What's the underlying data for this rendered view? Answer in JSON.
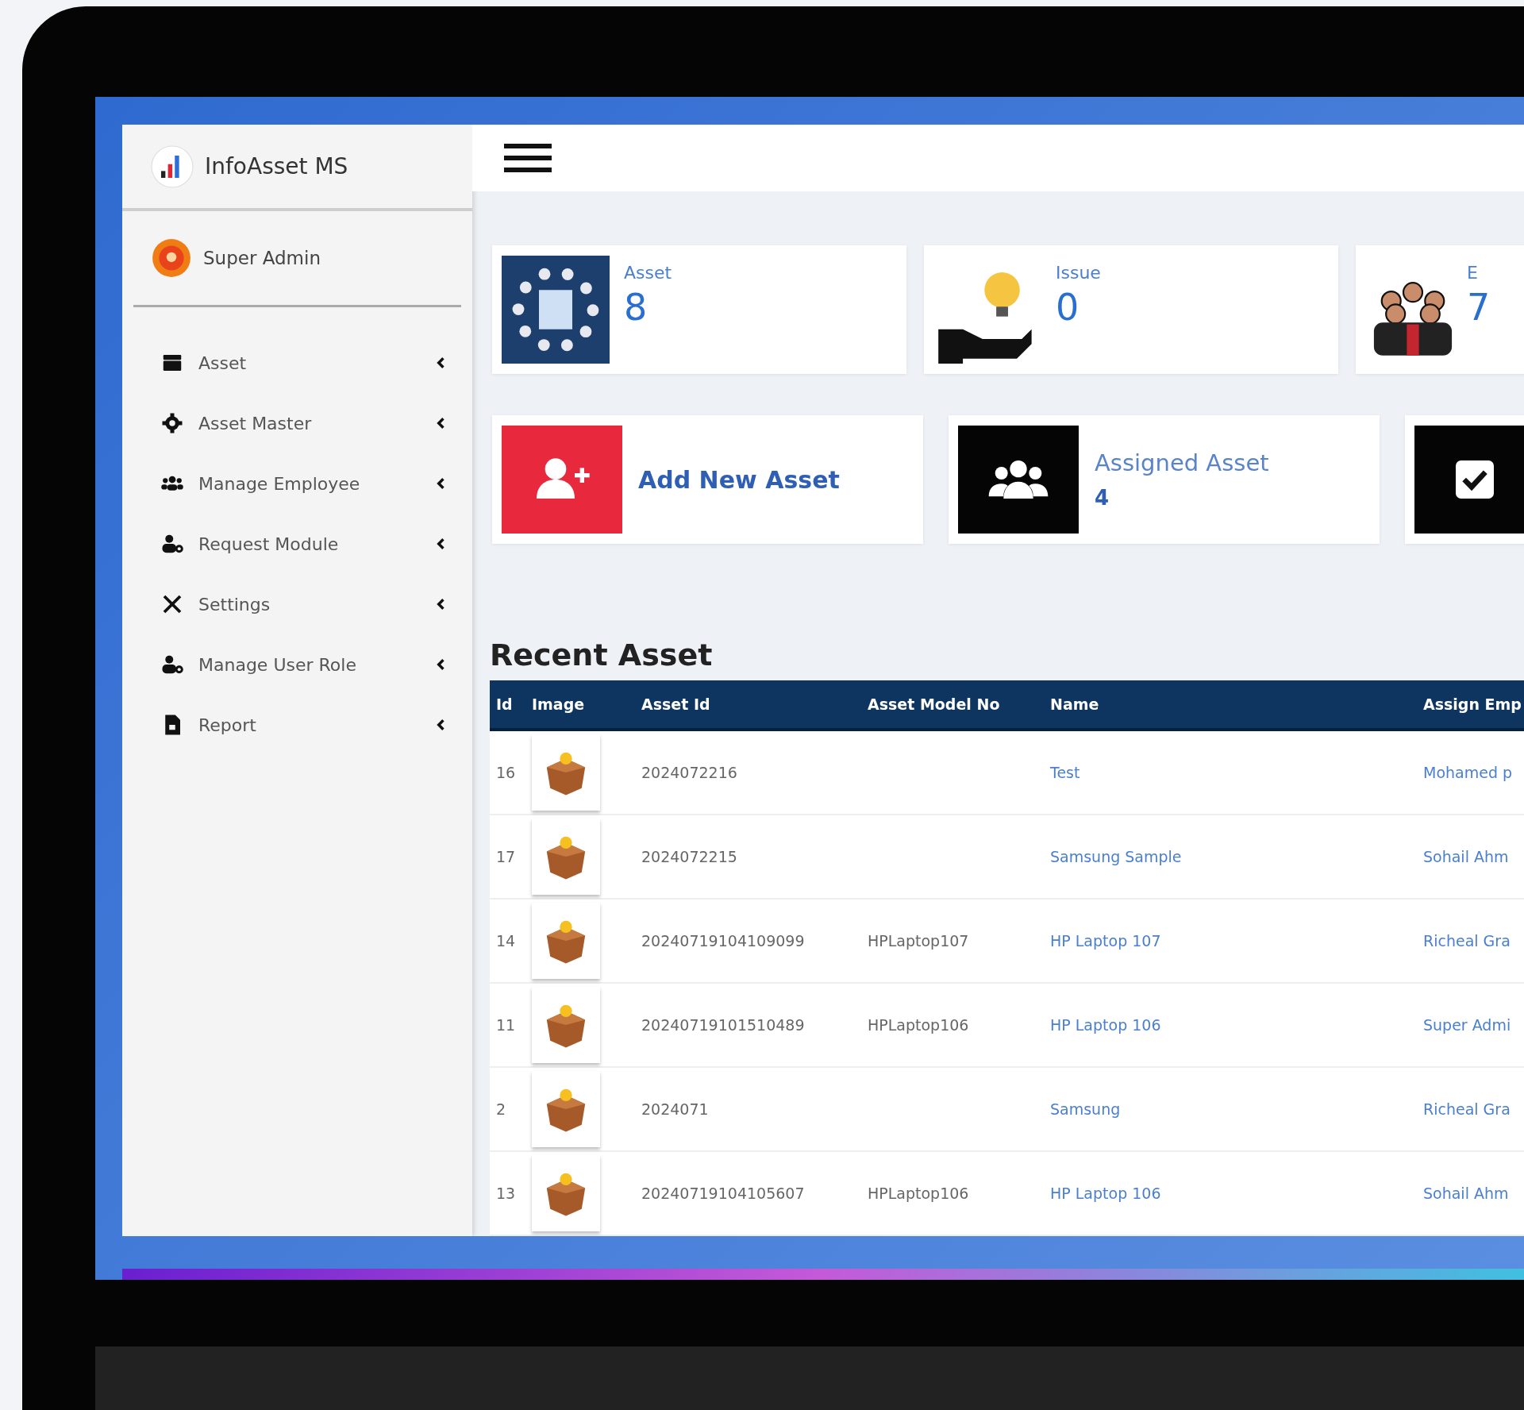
{
  "app": {
    "title": "InfoAsset MS"
  },
  "user": {
    "name": "Super Admin"
  },
  "menu": [
    {
      "label": "Asset",
      "kind": "box"
    },
    {
      "label": "Asset Master",
      "kind": "gear"
    },
    {
      "label": "Manage Employee",
      "kind": "users"
    },
    {
      "label": "Request Module",
      "kind": "user-gear"
    },
    {
      "label": "Settings",
      "kind": "tools"
    },
    {
      "label": "Manage User Role",
      "kind": "user-gear"
    },
    {
      "label": "Report",
      "kind": "file"
    }
  ],
  "stats": [
    {
      "label": "Asset",
      "value": "8",
      "kind": "asset"
    },
    {
      "label": "Issue",
      "value": "0",
      "kind": "issue"
    },
    {
      "label": "E",
      "value": "7",
      "kind": "team"
    }
  ],
  "actions": [
    {
      "label": "Add New Asset",
      "kind": "add"
    },
    {
      "label": "Assigned Asset",
      "value": "4",
      "kind": "assigned"
    },
    {
      "kind": "check"
    }
  ],
  "table": {
    "title": "Recent Asset",
    "columns": [
      "Id",
      "Image",
      "Asset Id",
      "Asset Model No",
      "Name",
      "Assign Emp"
    ],
    "rows": [
      {
        "id": "16",
        "asset_id": "2024072216",
        "name": "Test",
        "employee": "Mohamed p"
      },
      {
        "id": "17",
        "asset_id": "2024072215",
        "name": "Samsung Sample",
        "employee": "Sohail Ahm"
      },
      {
        "id": "14",
        "asset_id": "20240719104109099",
        "model": "HPLaptop107",
        "name": "HP Laptop 107",
        "employee": "Richeal Gra"
      },
      {
        "id": "11",
        "asset_id": "20240719101510489",
        "model": "HPLaptop106",
        "name": "HP Laptop 106",
        "employee": "Super Admi"
      },
      {
        "id": "2",
        "asset_id": "2024071",
        "name": "Samsung",
        "employee": "Richeal Gra"
      },
      {
        "id": "13",
        "asset_id": "20240719104105607",
        "model": "HPLaptop106",
        "name": "HP Laptop 106",
        "employee": "Sohail Ahm"
      }
    ]
  }
}
